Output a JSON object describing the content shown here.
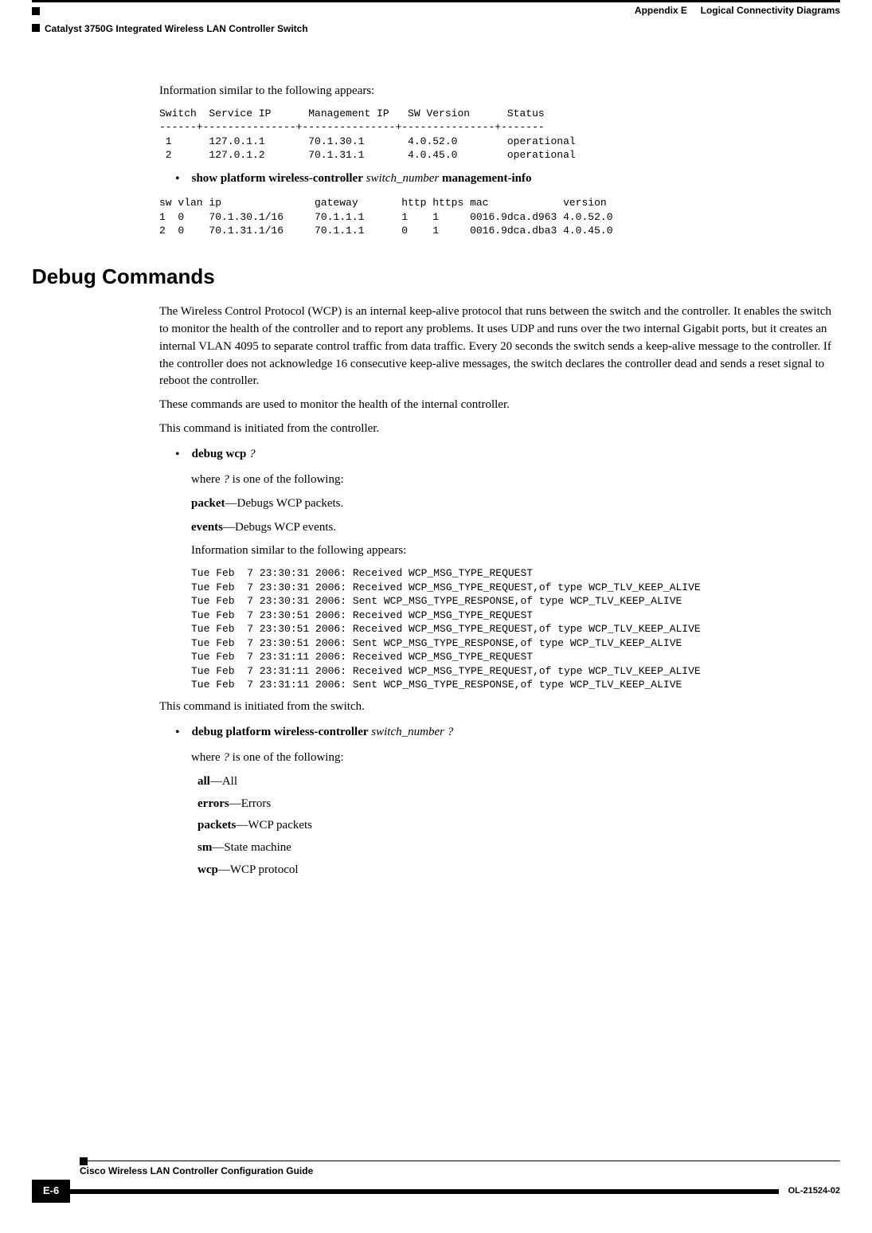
{
  "header": {
    "appendix": "Appendix E",
    "title": "Logical Connectivity Diagrams",
    "subtitle": "Catalyst 3750G Integrated Wireless LAN Controller Switch"
  },
  "body": {
    "intro_line": "Information similar to the following appears:",
    "code1": "Switch  Service IP      Management IP   SW Version      Status\n------+---------------+---------------+---------------+-------\n 1      127.0.1.1       70.1.30.1       4.0.52.0        operational\n 2      127.0.1.2       70.1.31.1       4.0.45.0        operational",
    "bullet1_cmd_prefix": "show platform wireless-controller",
    "bullet1_cmd_ital": "switch_number",
    "bullet1_cmd_suffix": "management-info",
    "code2": "sw vlan ip               gateway       http https mac            version\n1  0    70.1.30.1/16     70.1.1.1      1    1     0016.9dca.d963 4.0.52.0\n2  0    70.1.31.1/16     70.1.1.1      0    1     0016.9dca.dba3 4.0.45.0"
  },
  "section": {
    "heading": "Debug Commands",
    "p1": "The Wireless Control Protocol (WCP) is an internal keep-alive protocol that runs between the switch and the controller. It enables the switch to monitor the health of the controller and to report any problems. It uses UDP and runs over the two internal Gigabit ports, but it creates an internal VLAN 4095 to separate control traffic from data traffic. Every 20 seconds the switch sends a keep-alive message to the controller. If the controller does not acknowledge 16 consecutive keep-alive messages, the switch declares the controller dead and sends a reset signal to reboot the controller.",
    "p2": "These commands are used to monitor the health of the internal controller.",
    "p3": "This command is initiated from the controller.",
    "bullet2_cmd": "debug wcp",
    "bullet2_q": "?",
    "where_line_pre": "where ",
    "where_line_ital": "?",
    "where_line_post": " is one of the following:",
    "opt_packet_b": "packet",
    "opt_packet_t": "—Debugs WCP packets.",
    "opt_events_b": "events",
    "opt_events_t": "—Debugs WCP events.",
    "info_line2": "Information similar to the following appears:",
    "code3": "Tue Feb  7 23:30:31 2006: Received WCP_MSG_TYPE_REQUEST\nTue Feb  7 23:30:31 2006: Received WCP_MSG_TYPE_REQUEST,of type WCP_TLV_KEEP_ALIVE\nTue Feb  7 23:30:31 2006: Sent WCP_MSG_TYPE_RESPONSE,of type WCP_TLV_KEEP_ALIVE\nTue Feb  7 23:30:51 2006: Received WCP_MSG_TYPE_REQUEST\nTue Feb  7 23:30:51 2006: Received WCP_MSG_TYPE_REQUEST,of type WCP_TLV_KEEP_ALIVE\nTue Feb  7 23:30:51 2006: Sent WCP_MSG_TYPE_RESPONSE,of type WCP_TLV_KEEP_ALIVE\nTue Feb  7 23:31:11 2006: Received WCP_MSG_TYPE_REQUEST\nTue Feb  7 23:31:11 2006: Received WCP_MSG_TYPE_REQUEST,of type WCP_TLV_KEEP_ALIVE\nTue Feb  7 23:31:11 2006: Sent WCP_MSG_TYPE_RESPONSE,of type WCP_TLV_KEEP_ALIVE",
    "p4": "This command is initiated from the switch.",
    "bullet3_cmd_prefix": "debug platform wireless-controller",
    "bullet3_cmd_ital": "switch_number",
    "bullet3_cmd_q": "?",
    "opts": {
      "all_b": "all",
      "all_t": "—All",
      "errors_b": "errors",
      "errors_t": "—Errors",
      "packets_b": "packets",
      "packets_t": "—WCP packets",
      "sm_b": "sm",
      "sm_t": "—State machine",
      "wcp_b": "wcp",
      "wcp_t": "—WCP protocol"
    }
  },
  "footer": {
    "book_title": "Cisco Wireless LAN Controller Configuration Guide",
    "page_num": "E-6",
    "doc_num": "OL-21524-02"
  }
}
